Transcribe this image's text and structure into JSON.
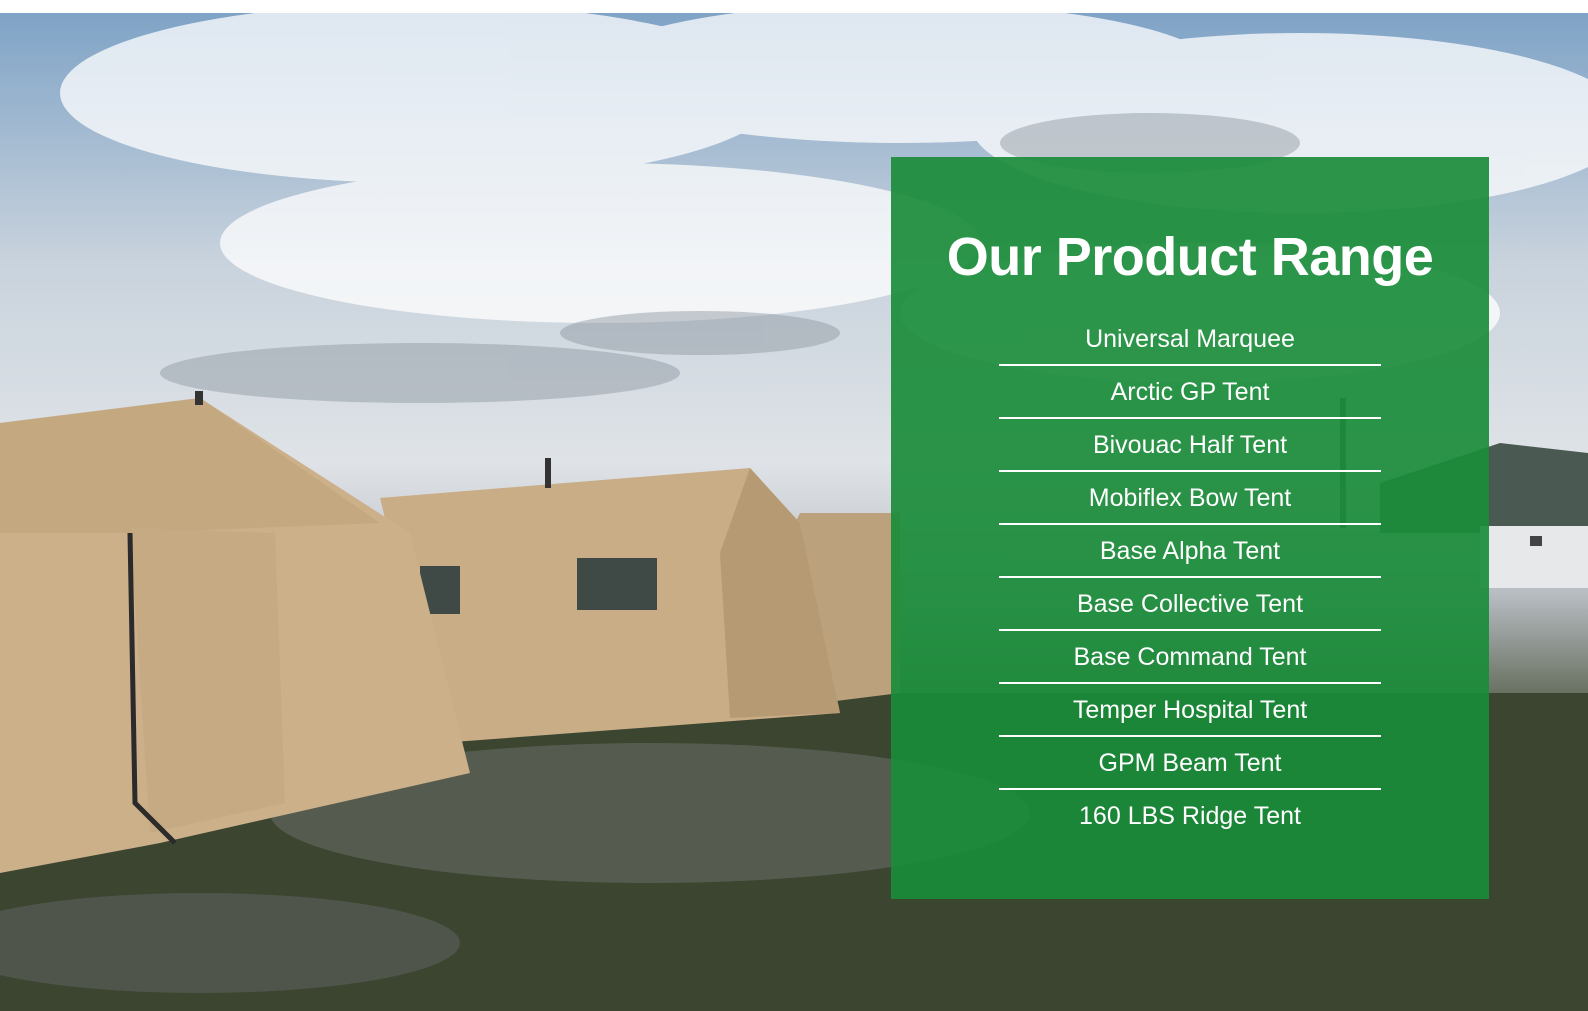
{
  "panel": {
    "title": "Our Product Range",
    "background_color": "#1a8c3a",
    "items": [
      {
        "label": "Universal Marquee"
      },
      {
        "label": "Arctic GP Tent"
      },
      {
        "label": "Bivouac Half Tent"
      },
      {
        "label": "Mobiflex Bow Tent"
      },
      {
        "label": "Base Alpha Tent"
      },
      {
        "label": "Base Collective Tent"
      },
      {
        "label": "Base Command Tent"
      },
      {
        "label": "Temper Hospital Tent"
      },
      {
        "label": "GPM Beam Tent"
      },
      {
        "label": "160 LBS Ridge Tent"
      }
    ]
  },
  "background": {
    "tent_color": "#cdb08a",
    "grass_color": "#3d4a33",
    "sky_color": "#dfe3e7"
  }
}
